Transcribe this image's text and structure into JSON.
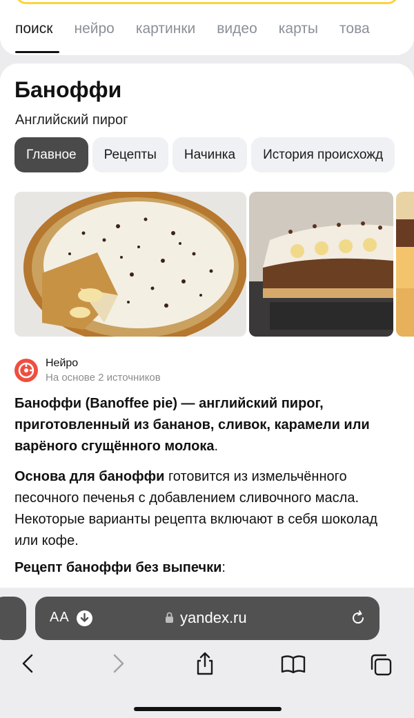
{
  "search_tabs": [
    "поиск",
    "нейро",
    "картинки",
    "видео",
    "карты",
    "това"
  ],
  "entity": {
    "title": "Баноффи",
    "subtitle": "Английский пирог"
  },
  "chips": [
    "Главное",
    "Рецепты",
    "Начинка",
    "История происхожд"
  ],
  "neuro": {
    "name": "Нейро",
    "sources": "На основе 2 источников"
  },
  "answer": {
    "p1_bold": "Баноффи (Banoffee pie) — английский пирог, приготовленный из бананов, сливок, карамели или варёного сгущённого молока",
    "p1_end": ".",
    "p2_bold": "Основа для баноффи",
    "p2_rest": " готовится из измельчённого песочного печенья с добавлением сливочного масла. Некоторые варианты рецепта включают в себя шоколад или кофе.",
    "p3_bold": "Рецепт баноффи без выпечки",
    "p3_end": ":"
  },
  "browser": {
    "text_size": "AA",
    "url": "yandex.ru"
  },
  "colors": {
    "accent_yellow": "#fcd33a",
    "neuro_red": "#ef4e3f",
    "active_chip": "#4a4a4a",
    "url_bar": "#515151"
  }
}
